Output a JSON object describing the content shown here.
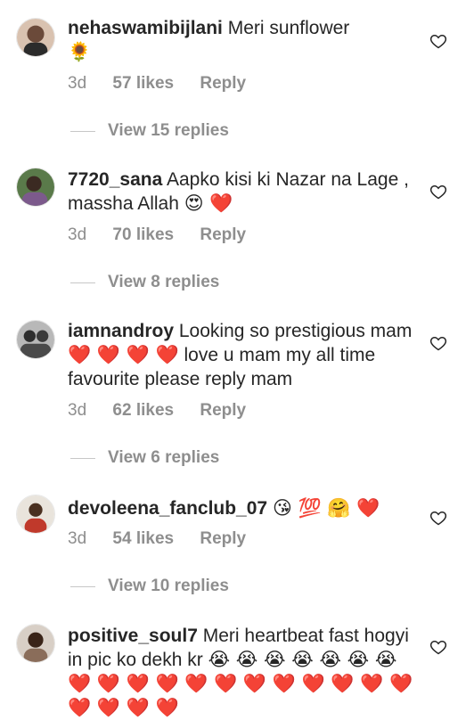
{
  "comments": [
    {
      "username": "nehaswamibijlani",
      "text": "Meri sunflower",
      "emoji": "🌻",
      "time": "3d",
      "likes": "57 likes",
      "reply": "Reply",
      "view_replies": "View 15 replies"
    },
    {
      "username": "7720_sana",
      "text": "Aapko kisi ki Nazar na Lage , massha Allah",
      "emoji": "😍 ❤️",
      "time": "3d",
      "likes": "70 likes",
      "reply": "Reply",
      "view_replies": "View 8 replies"
    },
    {
      "username": "iamnandroy",
      "text": "Looking so prestigious mam",
      "emoji": "❤️ ❤️ ❤️ ❤️",
      "text2": "love u mam my all time favourite please reply mam",
      "time": "3d",
      "likes": "62 likes",
      "reply": "Reply",
      "view_replies": "View 6 replies"
    },
    {
      "username": "devoleena_fanclub_07",
      "text": "",
      "emoji": "😘 💯 🤗 ❤️",
      "time": "3d",
      "likes": "54 likes",
      "reply": "Reply",
      "view_replies": "View 10 replies"
    },
    {
      "username": "positive_soul7",
      "text": "Meri heartbeat fast hogyi in pic ko dekh kr",
      "emoji": "😭 😭 😭 😭 😭 😭 😭 ❤️ ❤️ ❤️ ❤️ ❤️ ❤️ ❤️ ❤️ ❤️ ❤️ ❤️ ❤️ ❤️ ❤️ ❤️ ❤️"
    }
  ],
  "colors": {
    "text": "#262626",
    "secondary": "#8e8e8e",
    "divider": "#c7c7c7"
  },
  "icons": {
    "like": "heart-outline-icon"
  }
}
